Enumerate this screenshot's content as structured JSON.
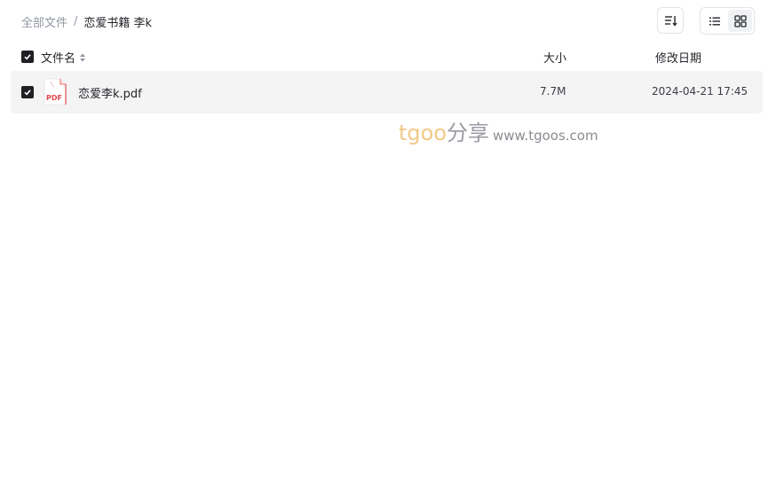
{
  "breadcrumb": {
    "root": "全部文件",
    "separator": "/",
    "current": "恋爱书籍 李k"
  },
  "toolbar": {
    "sort_icon": "sort-icon",
    "list_view_icon": "list-view-icon",
    "grid_view_icon": "grid-view-icon",
    "active_view": "list"
  },
  "table": {
    "columns": {
      "name": "文件名",
      "size": "大小",
      "date": "修改日期"
    },
    "rows": [
      {
        "name": "恋爱李k.pdf",
        "type_label": "PDF",
        "size": "7.7M",
        "modified": "2024-04-21 17:45",
        "checked": true
      }
    ]
  },
  "watermark": {
    "brand": "tgoo",
    "share": "分享",
    "url": "www.tgoos.com"
  },
  "colors": {
    "checkbox": "#1f2024",
    "row_bg": "#f4f4f5",
    "pdf_red": "#e5484d",
    "watermark_orange": "#f2c987"
  }
}
